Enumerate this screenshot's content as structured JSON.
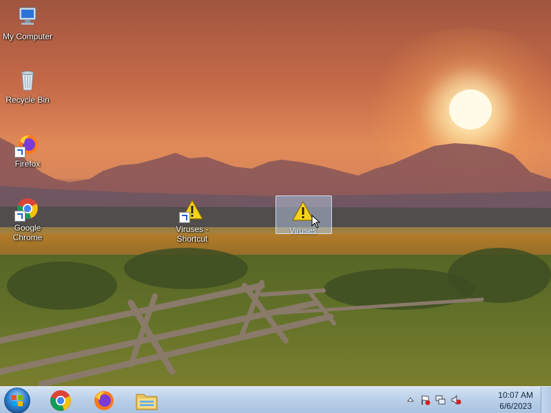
{
  "desktop": {
    "icons": [
      {
        "label": "My Computer"
      },
      {
        "label": "Recycle Bin"
      },
      {
        "label": "Firefox"
      },
      {
        "label": "Google Chrome"
      },
      {
        "label": "Viruses - Shortcut"
      },
      {
        "label": "Viruses"
      }
    ]
  },
  "taskbar": {
    "pinned": [
      "start-orb",
      "chrome-icon",
      "firefox-icon",
      "explorer-icon"
    ],
    "clock": {
      "time": "10:07 AM",
      "date": "6/6/2023"
    }
  },
  "colors": {
    "taskbar": "#b9cfe8",
    "selection": "#bed7f5"
  }
}
